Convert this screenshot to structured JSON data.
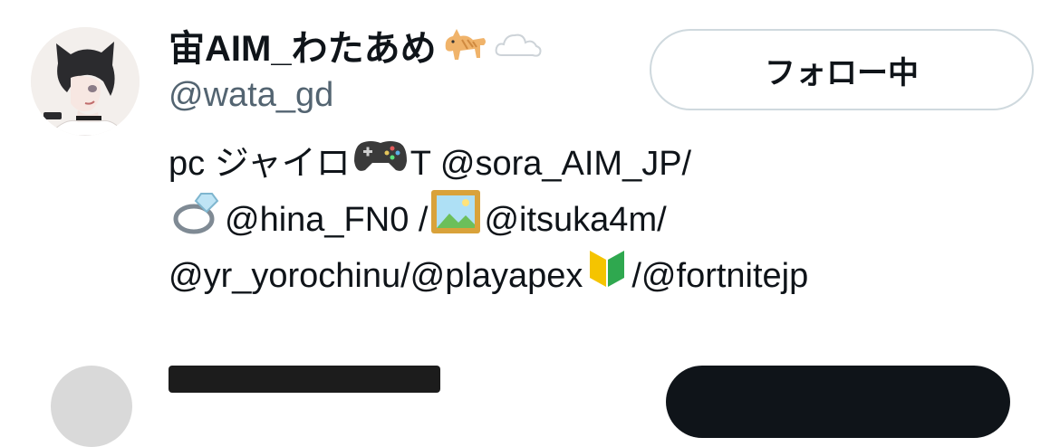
{
  "user": {
    "display_name": "宙AIM_わたあめ",
    "handle": "@wata_gd",
    "follow_button_label": "フォロー中",
    "name_emojis": [
      "cat-icon",
      "cloud-icon"
    ]
  },
  "bio": {
    "line1": {
      "prefix": "pc ジャイロ",
      "after_icon": "T @sora_AIM_JP/"
    },
    "line2": {
      "mention1": "@hina_FN0 /",
      "mention2": " @itsuka4m/"
    },
    "line3": {
      "mention1": "@yr_yorochinu/@playapex",
      "mention2": " /@fortnitejp"
    }
  },
  "colors": {
    "text": "#0f1419",
    "secondary": "#536471",
    "button_border": "#cfd9de"
  }
}
